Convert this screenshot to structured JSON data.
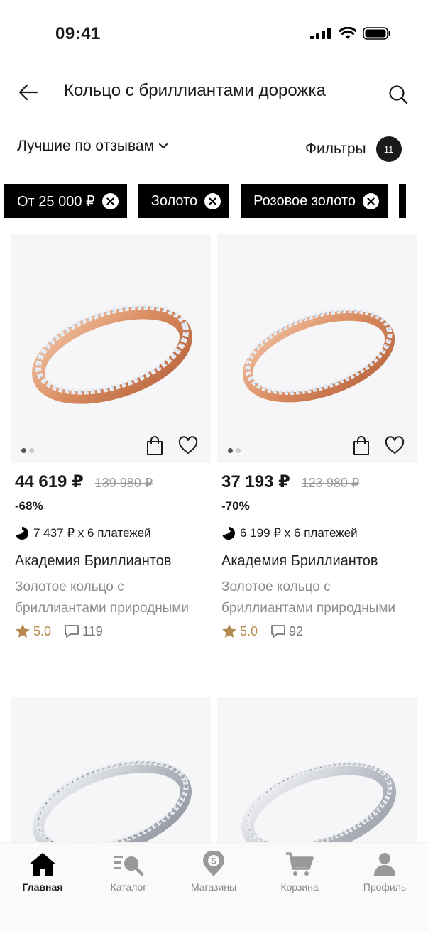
{
  "status_bar": {
    "time": "09:41"
  },
  "header": {
    "title": "Кольцо с бриллиантами дорожка"
  },
  "sort": {
    "label": "Лучшие по отзывам"
  },
  "filters": {
    "label": "Фильтры",
    "count": "11"
  },
  "chips": [
    {
      "label": "От 25 000 ₽"
    },
    {
      "label": "Золото"
    },
    {
      "label": "Розовое золото"
    }
  ],
  "products": [
    {
      "price": "44 619 ₽",
      "old_price": "139 980 ₽",
      "discount": "-68%",
      "installment": "7 437 ₽ x 6 платежей",
      "brand": "Академия Бриллиантов",
      "description": "Золотое кольцо с бриллиантами природными",
      "rating": "5.0",
      "reviews": "119",
      "metal": "rose"
    },
    {
      "price": "37 193 ₽",
      "old_price": "123 980 ₽",
      "discount": "-70%",
      "installment": "6 199 ₽ x 6 платежей",
      "brand": "Академия Бриллиантов",
      "description": "Золотое кольцо с бриллиантами природными",
      "rating": "5.0",
      "reviews": "92",
      "metal": "rose"
    },
    {
      "metal": "white"
    },
    {
      "metal": "white"
    }
  ],
  "tab_bar": {
    "items": [
      {
        "label": "Главная",
        "icon": "home-icon",
        "active": true
      },
      {
        "label": "Каталог",
        "icon": "catalog-icon"
      },
      {
        "label": "Магазины",
        "icon": "store-location-icon"
      },
      {
        "label": "Корзина",
        "icon": "cart-icon"
      },
      {
        "label": "Профиль",
        "icon": "profile-icon"
      }
    ]
  },
  "colors": {
    "accent": "#1a1a1a",
    "rating": "#b68a4e",
    "card_bg": "#f6f5f7"
  }
}
